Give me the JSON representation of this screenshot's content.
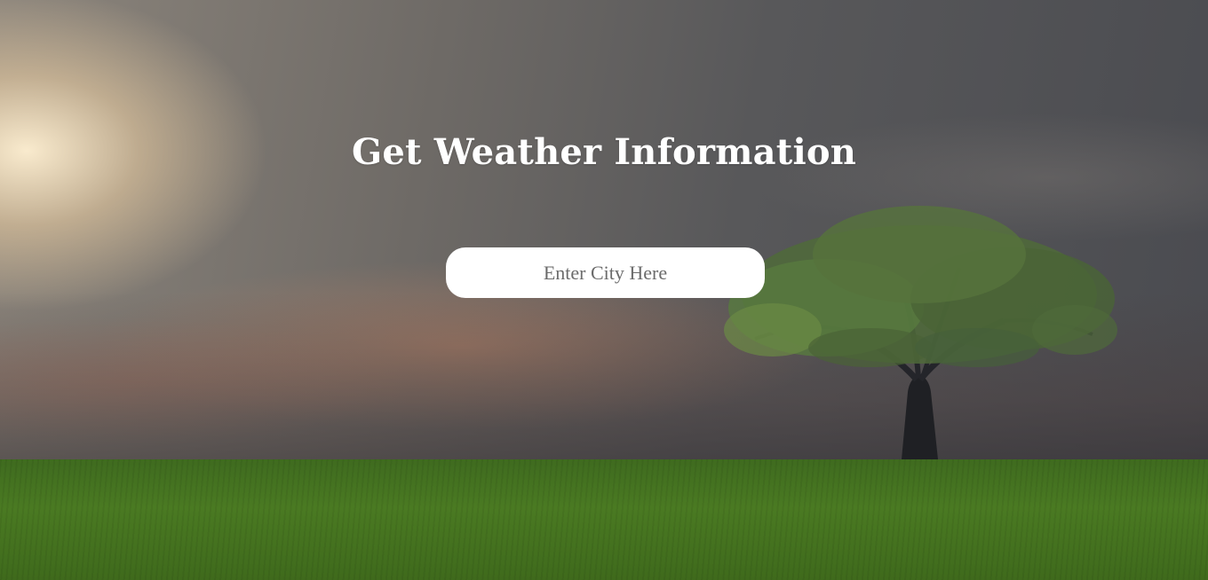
{
  "page": {
    "title": "Get Weather Information"
  },
  "search": {
    "value": "",
    "placeholder": "Enter City Here"
  },
  "colors": {
    "title_text": "#ffffff",
    "input_background": "#ffffff",
    "placeholder_text": "#6b6b6b"
  },
  "background": {
    "scene_description": "",
    "icons": [
      "tree-icon"
    ]
  }
}
